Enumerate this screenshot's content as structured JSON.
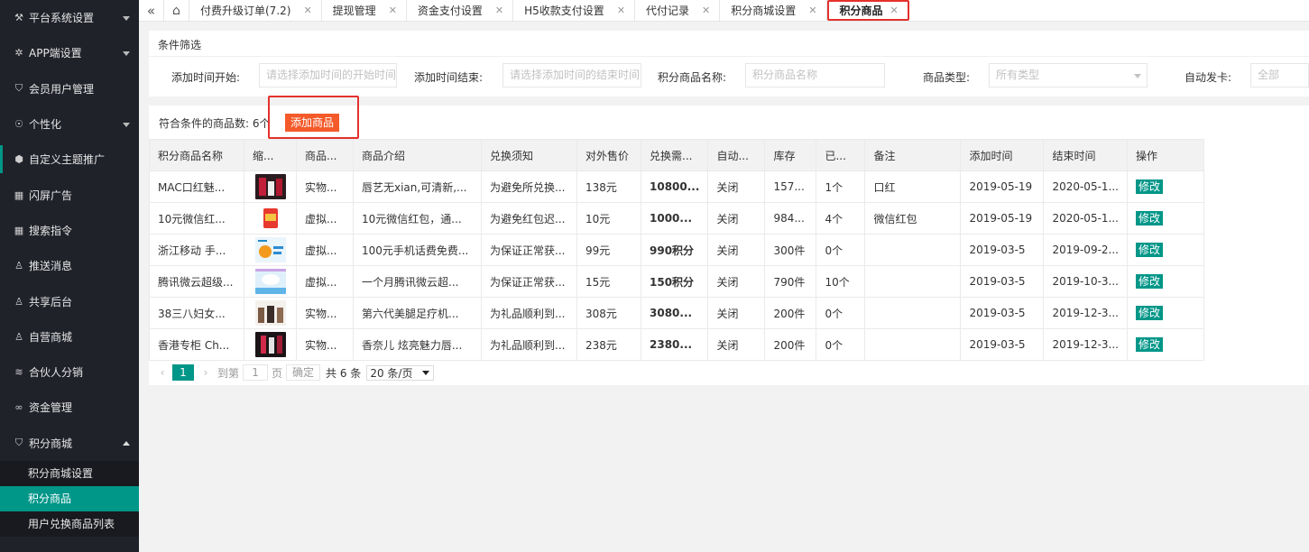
{
  "sidebar": {
    "items": [
      {
        "label": "平台系统设置",
        "icon": "tools-icon",
        "glyph": "⚒"
      },
      {
        "label": "APP端设置",
        "icon": "gear-icon",
        "glyph": "✲"
      },
      {
        "label": "会员用户管理",
        "icon": "shield-icon",
        "glyph": "⛉"
      },
      {
        "label": "个性化",
        "icon": "palette-icon",
        "glyph": "☉"
      },
      {
        "label": "自定义主题推广",
        "icon": "cube-icon",
        "glyph": "⬢"
      },
      {
        "label": "闪屏广告",
        "icon": "grid-icon",
        "glyph": "▦"
      },
      {
        "label": "搜索指令",
        "icon": "grid-icon",
        "glyph": "▦"
      },
      {
        "label": "推送消息",
        "icon": "user-icon",
        "glyph": "♙"
      },
      {
        "label": "共享后台",
        "icon": "user-icon",
        "glyph": "♙"
      },
      {
        "label": "自营商城",
        "icon": "user-icon",
        "glyph": "♙"
      },
      {
        "label": "合伙人分销",
        "icon": "layers-icon",
        "glyph": "≋"
      },
      {
        "label": "资金管理",
        "icon": "link-icon",
        "glyph": "∞"
      },
      {
        "label": "积分商城",
        "icon": "shield-icon",
        "glyph": "⛉"
      }
    ],
    "subitems": [
      "积分商城设置",
      "积分商品",
      "用户兑换商品列表"
    ]
  },
  "tabs": {
    "collapse_glyph": "«",
    "home_glyph": "⌂",
    "close_glyph": "✕",
    "items": [
      "付费升级订单(7.2)",
      "提现管理",
      "资金支付设置",
      "H5收款支付设置",
      "代付记录",
      "积分商城设置",
      "积分商品"
    ]
  },
  "filter": {
    "title": "条件筛选",
    "start_label": "添加时间开始:",
    "start_placeholder": "请选择添加时间的开始时间",
    "end_label": "添加时间结束:",
    "end_placeholder": "请选择添加时间的结束时间",
    "name_label": "积分商品名称:",
    "name_placeholder": "积分商品名称",
    "type_label": "商品类型:",
    "type_value": "所有类型",
    "auto_label": "自动发卡:",
    "auto_value": "全部"
  },
  "result": {
    "count_label": "符合条件的商品数:",
    "count_value": "6个",
    "add_button": "添加商品"
  },
  "table": {
    "headers": [
      "积分商品名称",
      "缩...",
      "商品...",
      "商品介绍",
      "兑换须知",
      "对外售价",
      "兑换需...",
      "自动...",
      "库存",
      "已...",
      "备注",
      "添加时间",
      "结束时间",
      "操作"
    ],
    "rows": [
      {
        "name": "MAC口红魅...",
        "thumb": "lipstick",
        "type": "实物...",
        "intro": "唇艺无xian,可清新,...",
        "notice": "为避免所兑换...",
        "price": "138元",
        "points": "10800...",
        "auto": "关闭",
        "stock": "157...",
        "sold": "1个",
        "remark": "口红",
        "added": "2019-05-19",
        "end": "2020-05-1...",
        "action": "修改"
      },
      {
        "name": "10元微信红...",
        "thumb": "redpacket",
        "type": "虚拟...",
        "intro": "10元微信红包，通...",
        "notice": "为避免红包迟...",
        "price": "10元",
        "points": "1000...",
        "auto": "关闭",
        "stock": "984...",
        "sold": "4个",
        "remark": "微信红包",
        "added": "2019-05-19",
        "end": "2020-05-1...",
        "action": "修改"
      },
      {
        "name": "浙江移动 手...",
        "thumb": "mobile",
        "type": "虚拟...",
        "intro": "100元手机话费免费...",
        "notice": "为保证正常获...",
        "price": "99元",
        "points": "990积分",
        "auto": "关闭",
        "stock": "300件",
        "sold": "0个",
        "remark": "",
        "added": "2019-03-5",
        "end": "2019-09-2...",
        "action": "修改"
      },
      {
        "name": "腾讯微云超级...",
        "thumb": "cloud",
        "type": "虚拟...",
        "intro": "一个月腾讯微云超...",
        "notice": "为保证正常获...",
        "price": "15元",
        "points": "150积分",
        "auto": "关闭",
        "stock": "790件",
        "sold": "10个",
        "remark": "",
        "added": "2019-03-5",
        "end": "2019-10-3...",
        "action": "修改"
      },
      {
        "name": "38三八妇女...",
        "thumb": "massager",
        "type": "实物...",
        "intro": "第六代美腿足疗机...",
        "notice": "为礼品顺利到...",
        "price": "308元",
        "points": "3080...",
        "auto": "关闭",
        "stock": "200件",
        "sold": "0个",
        "remark": "",
        "added": "2019-03-5",
        "end": "2019-12-3...",
        "action": "修改"
      },
      {
        "name": "香港专柜 Ch...",
        "thumb": "perfume",
        "type": "实物...",
        "intro": "香奈儿 炫亮魅力唇...",
        "notice": "为礼品顺利到...",
        "price": "238元",
        "points": "2380...",
        "auto": "关闭",
        "stock": "200件",
        "sold": "0个",
        "remark": "",
        "added": "2019-03-5",
        "end": "2019-12-3...",
        "action": "修改"
      }
    ]
  },
  "pager": {
    "prev": "‹",
    "next": "›",
    "current": "1",
    "goto_label": "到第",
    "goto_value": "1",
    "page_unit": "页",
    "confirm": "确定",
    "total": "共 6 条",
    "page_size": "20 条/页"
  },
  "colors": {
    "sidebar_bg": "#20222a",
    "accent": "#009688",
    "add_button": "#f45a2a",
    "highlight_border": "#e3312d"
  }
}
